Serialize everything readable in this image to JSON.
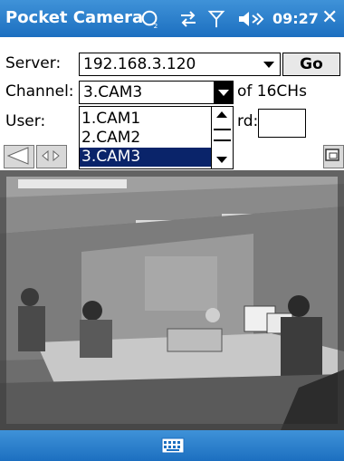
{
  "titlebar": {
    "title": "Pocket Camera",
    "time": "09:27",
    "icons": [
      "notification-icon",
      "connectivity-icon",
      "signal-icon",
      "volume-icon"
    ],
    "close_label": "✕"
  },
  "form": {
    "server_label": "Server:",
    "server_value": "192.168.3.120",
    "go_label": "Go",
    "channel_label": "Channel:",
    "channel_value": "3.CAM3",
    "channel_count": "of 16CHs",
    "user_label": "User:",
    "password_label_partial": "rd:"
  },
  "channel_options": [
    "1.CAM1",
    "2.CAM2",
    "3.CAM3"
  ],
  "channel_selected_index": 2,
  "colors": {
    "bar_blue": "#2a7fcf",
    "selection": "#0a246a"
  },
  "camera": {
    "description_icon": "live-video-feed"
  },
  "bottombar": {
    "icon": "keyboard-icon"
  }
}
